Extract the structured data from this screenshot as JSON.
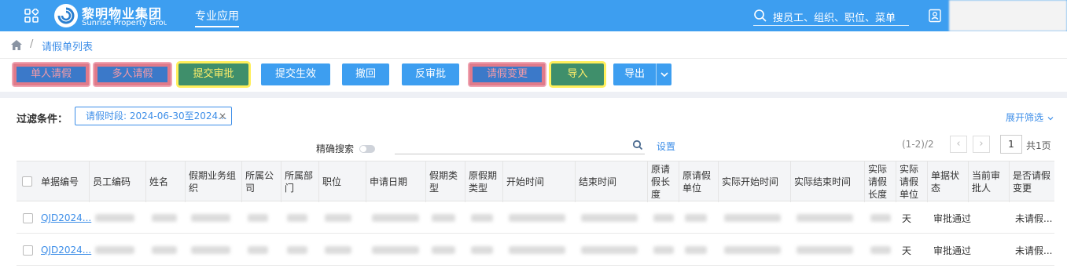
{
  "header": {
    "logo_cn": "黎明物业集团",
    "logo_en": "Sunrise Property Group",
    "nav_tab": "专业应用",
    "search_placeholder": "搜员工、组织、职位、菜单"
  },
  "breadcrumb": {
    "current": "请假单列表",
    "separator": "/"
  },
  "toolbar": {
    "single_leave": "单人请假",
    "multi_leave": "多人请假",
    "submit_approval": "提交审批",
    "submit_effective": "提交生效",
    "withdraw": "撤回",
    "reverse_approval": "反审批",
    "leave_change": "请假变更",
    "import": "导入",
    "export": "导出"
  },
  "filter": {
    "label": "过滤条件：",
    "tag": "请假时段: 2024-06-30至2024...",
    "expand": "展开筛选"
  },
  "search_bar": {
    "exact_label": "精确搜索",
    "settings": "设置"
  },
  "pager": {
    "info": "(1-2)/2",
    "prev": "‹",
    "next": "›",
    "current": "1",
    "total": "共1页"
  },
  "table": {
    "columns": [
      "单据编号",
      "员工编码",
      "姓名",
      "假期业务组织",
      "所属公司",
      "所属部门",
      "职位",
      "申请日期",
      "假期类型",
      "原假期类型",
      "开始时间",
      "结束时间",
      "原请假长度",
      "原请假单位",
      "实际开始时间",
      "实际结束时间",
      "实际请假长度",
      "实际请假单位",
      "单据状态",
      "当前审批人",
      "是否请假变更"
    ],
    "rows": [
      {
        "doc_no": "QJD2024...",
        "unit": "天",
        "status": "审批通过",
        "changed": "未请假..."
      },
      {
        "doc_no": "QJD2024...",
        "unit": "天",
        "status": "审批通过",
        "changed": "未请假..."
      }
    ]
  },
  "colors": {
    "primary": "#3d9ef0",
    "link": "#3d8ee8",
    "highlight_pink": "#e07a8a",
    "highlight_yellow": "#ffef5a"
  }
}
